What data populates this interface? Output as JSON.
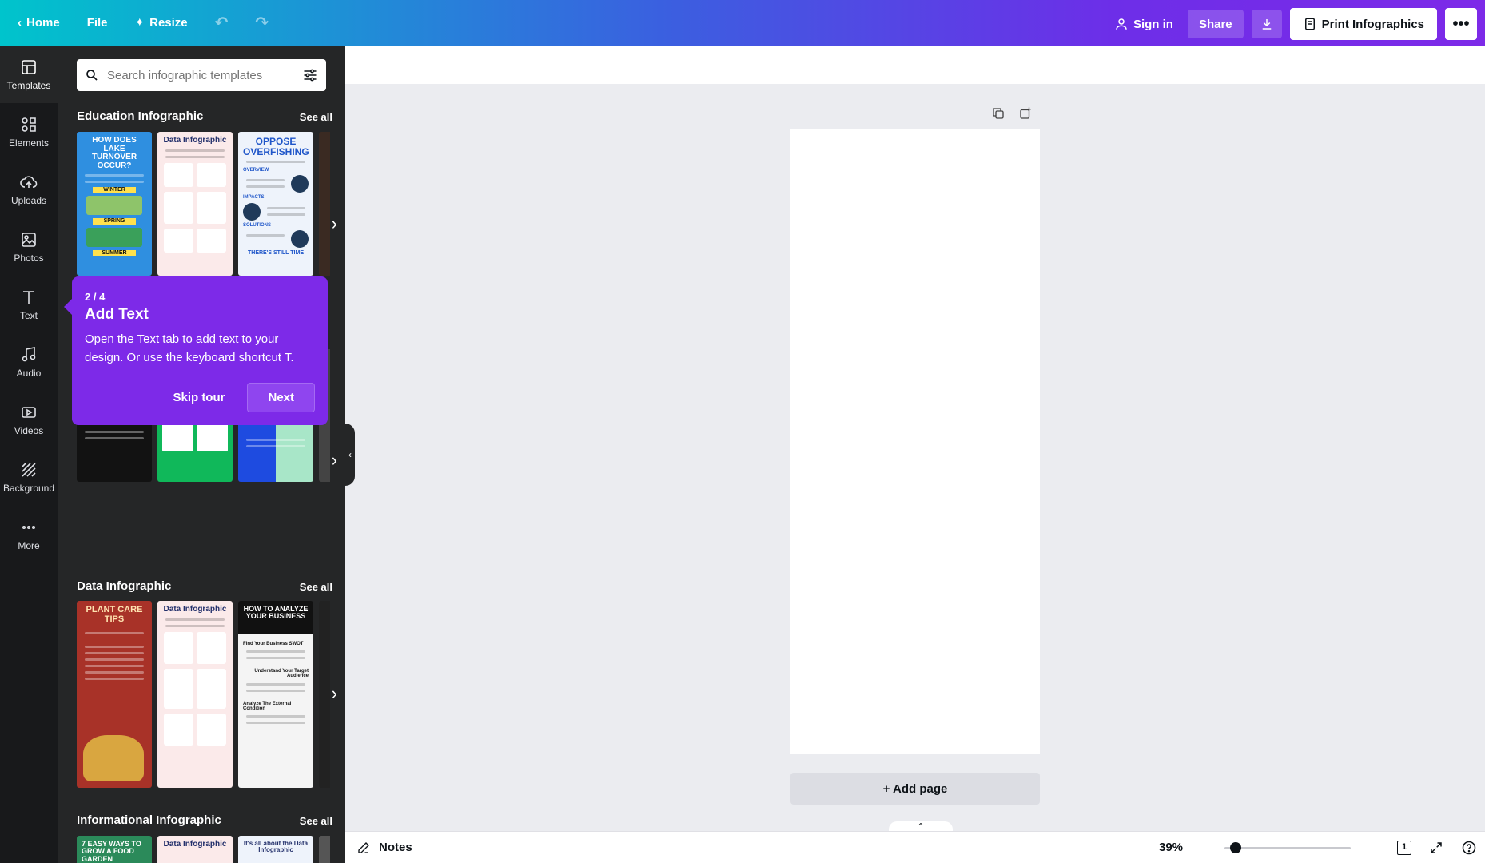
{
  "topbar": {
    "home": "Home",
    "file": "File",
    "resize": "Resize",
    "sign_in": "Sign in",
    "share": "Share",
    "print": "Print Infographics"
  },
  "rail": [
    {
      "label": "Templates",
      "icon": "templates-icon"
    },
    {
      "label": "Elements",
      "icon": "elements-icon"
    },
    {
      "label": "Uploads",
      "icon": "uploads-icon"
    },
    {
      "label": "Photos",
      "icon": "photos-icon"
    },
    {
      "label": "Text",
      "icon": "text-icon"
    },
    {
      "label": "Audio",
      "icon": "audio-icon"
    },
    {
      "label": "Videos",
      "icon": "videos-icon"
    },
    {
      "label": "Background",
      "icon": "background-icon"
    },
    {
      "label": "More",
      "icon": "more-icon"
    }
  ],
  "search": {
    "placeholder": "Search infographic templates"
  },
  "sections": [
    {
      "title": "Education Infographic",
      "see_all": "See all",
      "thumbs": [
        {
          "title": "HOW DOES LAKE TURNOVER OCCUR?",
          "labels": [
            "WINTER",
            "SPRING",
            "SUMMER"
          ],
          "bg": "#2f8fe0",
          "fg": "#ffffff"
        },
        {
          "title": "Data Infographic",
          "bg": "#fbeaea",
          "fg": "#23306b"
        },
        {
          "title": "OPPOSE OVERFISHING",
          "labels": [
            "OVERVIEW",
            "IMPACTS",
            "SOLUTIONS",
            "THERE'S STILL TIME"
          ],
          "bg": "#eef3fb",
          "fg": "#1f56c9"
        }
      ]
    },
    {
      "title": "",
      "see_all": "",
      "thumbs": [
        {
          "title": "",
          "bg": "#121212",
          "fg": "#ffffff"
        },
        {
          "title": "",
          "bg": "#10b85a",
          "fg": "#ffffff"
        },
        {
          "title": "",
          "bg": "#1e4be0",
          "fg": "#ffffff"
        }
      ]
    },
    {
      "title": "Data Infographic",
      "see_all": "See all",
      "thumbs": [
        {
          "title": "PLANT CARE TIPS",
          "bg": "#a83228",
          "fg": "#ffe3b0"
        },
        {
          "title": "Data Infographic",
          "bg": "#fbeaea",
          "fg": "#23306b"
        },
        {
          "title": "HOW TO ANALYZE YOUR BUSINESS",
          "labels": [
            "Find Your Business SWOT",
            "Understand Your Target Audience",
            "Analyze The External Condition"
          ],
          "bg": "#f4f4f4",
          "fg": "#111111"
        }
      ]
    },
    {
      "title": "Informational Infographic",
      "see_all": "See all",
      "thumbs": [
        {
          "title": "7 EASY WAYS TO GROW A FOOD GARDEN",
          "bg": "#2b8a5a",
          "fg": "#ffffff"
        },
        {
          "title": "Data Infographic",
          "bg": "#fbeaea",
          "fg": "#23306b"
        },
        {
          "title": "It's all about the Data Infographic",
          "bg": "#eef3fb",
          "fg": "#23306b"
        }
      ]
    }
  ],
  "tour": {
    "step": "2 / 4",
    "title": "Add Text",
    "body": "Open the Text tab to add text to your design. Or use the keyboard shortcut T.",
    "skip": "Skip tour",
    "next": "Next"
  },
  "canvas": {
    "add_page": "+ Add page"
  },
  "footer": {
    "notes": "Notes",
    "zoom": "39%",
    "zoom_level": 0.05,
    "page_count": "1"
  },
  "colors": {
    "accent": "#7d2ae8",
    "panel": "#252627",
    "rail": "#18191b"
  }
}
